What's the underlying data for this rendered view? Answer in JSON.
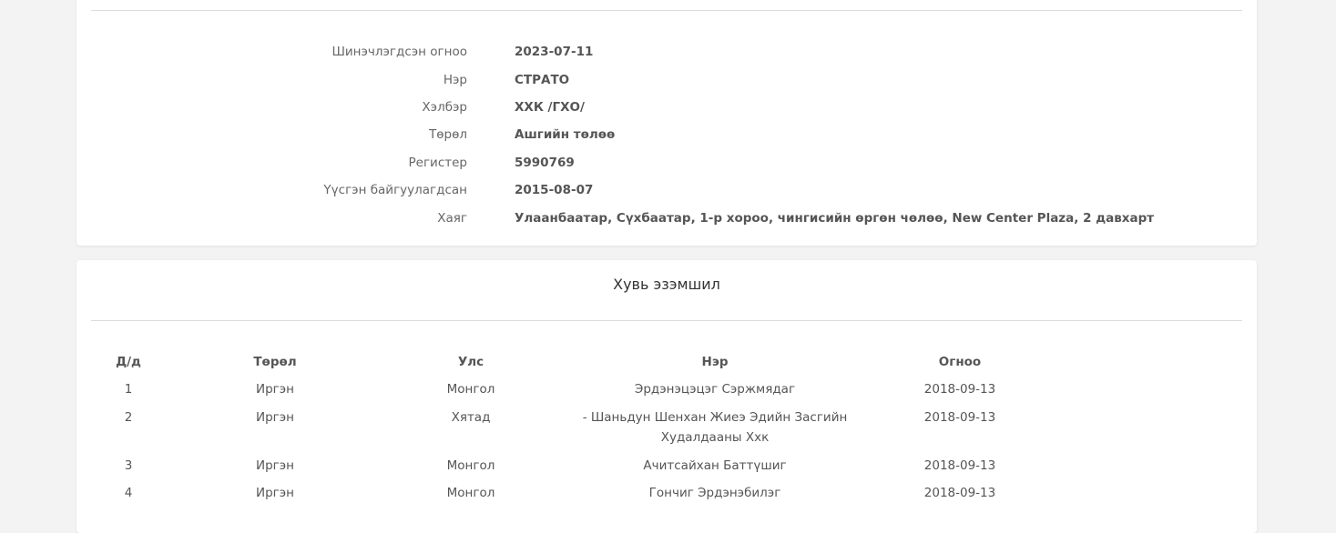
{
  "company_info": {
    "rows": [
      {
        "label": "Шинэчлэгдсэн огноо",
        "value": "2023-07-11"
      },
      {
        "label": "Нэр",
        "value": "СТРАТО"
      },
      {
        "label": "Хэлбэр",
        "value": "ХХК /ГХО/"
      },
      {
        "label": "Төрөл",
        "value": "Ашгийн төлөө"
      },
      {
        "label": "Регистер",
        "value": "5990769"
      },
      {
        "label": "Үүсгэн байгуулагдсан",
        "value": "2015-08-07"
      },
      {
        "label": "Хаяг",
        "value": "Улаанбаатар, Сүхбаатар, 1-р хороо, чингисийн өргөн чөлөө, New Center Plaza, 2 давхарт"
      }
    ]
  },
  "ownership": {
    "title": "Хувь эзэмшил",
    "columns": [
      "Д/д",
      "Төрөл",
      "Улс",
      "Нэр",
      "Огноо"
    ],
    "rows": [
      {
        "index": "1",
        "type": "Иргэн",
        "country": "Монгол",
        "name": "Эрдэнэцэцэг Сэржмядаг",
        "date": "2018-09-13"
      },
      {
        "index": "2",
        "type": "Иргэн",
        "country": "Хятад",
        "name": "- Шаньдун Шенхан Жиеэ Эдийн Засгийн Худалдааны Ххк",
        "date": "2018-09-13"
      },
      {
        "index": "3",
        "type": "Иргэн",
        "country": "Монгол",
        "name": "Ачитсайхан Баттүшиг",
        "date": "2018-09-13"
      },
      {
        "index": "4",
        "type": "Иргэн",
        "country": "Монгол",
        "name": "Гончиг Эрдэнэбилэг",
        "date": "2018-09-13"
      }
    ]
  }
}
